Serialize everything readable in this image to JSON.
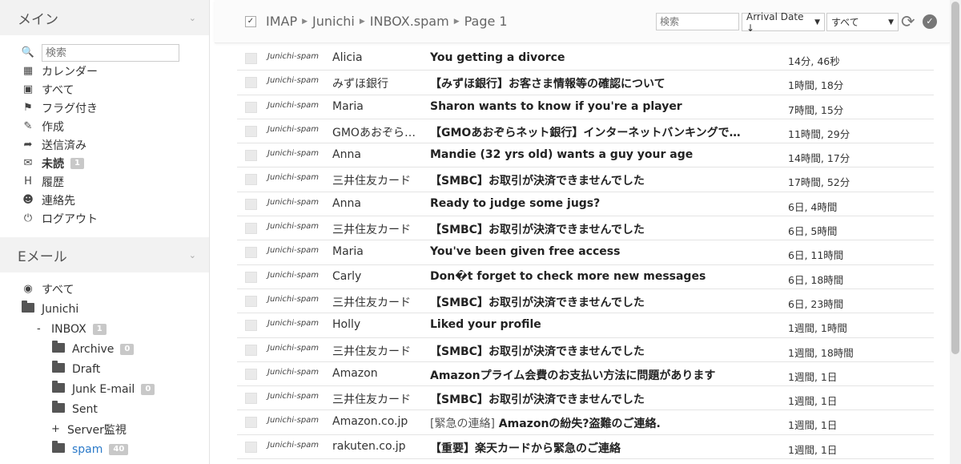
{
  "sidebar": {
    "main_section": {
      "title": "メイン",
      "search_placeholder": "検索",
      "items": [
        {
          "label": "カレンダー",
          "icon": "calendar-icon"
        },
        {
          "label": "すべて",
          "icon": "inbox-icon"
        },
        {
          "label": "フラグ付き",
          "icon": "flag-icon"
        },
        {
          "label": "作成",
          "icon": "compose-icon"
        },
        {
          "label": "送信済み",
          "icon": "sent-icon"
        },
        {
          "label": "未読",
          "icon": "envelope-icon",
          "badge": "1"
        },
        {
          "label": "履歴",
          "icon": "history-icon"
        },
        {
          "label": "連絡先",
          "icon": "contacts-icon"
        },
        {
          "label": "ログアウト",
          "icon": "power-icon"
        }
      ]
    },
    "email_section": {
      "title": "Eメール",
      "tree": {
        "all": "すべて",
        "account": "Junichi",
        "inbox": {
          "label": "INBOX",
          "badge": "1",
          "toggle": "-"
        },
        "archive": {
          "label": "Archive",
          "badge": "0"
        },
        "draft": {
          "label": "Draft"
        },
        "junk": {
          "label": "Junk E-mail",
          "badge": "0"
        },
        "sent": {
          "label": "Sent"
        },
        "server": {
          "label": "Server監視",
          "toggle": "+"
        },
        "spam": {
          "label": "spam",
          "badge": "40"
        }
      }
    }
  },
  "toolbar": {
    "breadcrumb": [
      "IMAP",
      "Junichi",
      "INBOX.spam",
      "Page 1"
    ],
    "search_placeholder": "検索",
    "sort_value": "Arrival Date ↓",
    "filter_value": "すべて"
  },
  "messages": [
    {
      "account": "Junichi-spam",
      "from": "Alicia",
      "subject": "You getting a divorce",
      "date": "14分, 46秒"
    },
    {
      "account": "Junichi-spam",
      "from": "みずほ銀行",
      "subject": "【みずほ銀行】お客さま情報等の確認について",
      "date": "1時間, 18分"
    },
    {
      "account": "Junichi-spam",
      "from": "Maria",
      "subject": "Sharon wants to know if you're a player",
      "date": "7時間, 15分"
    },
    {
      "account": "Junichi-spam",
      "from": "GMOあおぞら…",
      "subject": "【GMOあおぞらネット銀行】インターネットバンキングで…",
      "date": "11時間, 29分"
    },
    {
      "account": "Junichi-spam",
      "from": "Anna",
      "subject": "Mandie (32 yrs old) wants a guy your age",
      "date": "14時間, 17分"
    },
    {
      "account": "Junichi-spam",
      "from": "三井住友カード",
      "subject": "【SMBC】お取引が決済できませんでした",
      "date": "17時間, 52分"
    },
    {
      "account": "Junichi-spam",
      "from": "Anna",
      "subject": "Ready to judge some jugs?",
      "date": "6日, 4時間"
    },
    {
      "account": "Junichi-spam",
      "from": "三井住友カード",
      "subject": "【SMBC】お取引が決済できませんでした",
      "date": "6日, 5時間"
    },
    {
      "account": "Junichi-spam",
      "from": "Maria",
      "subject": "You've been given free access",
      "date": "6日, 11時間"
    },
    {
      "account": "Junichi-spam",
      "from": "Carly",
      "subject": "Don�t forget to check more new messages",
      "date": "6日, 18時間"
    },
    {
      "account": "Junichi-spam",
      "from": "三井住友カード",
      "subject": "【SMBC】お取引が決済できませんでした",
      "date": "6日, 23時間"
    },
    {
      "account": "Junichi-spam",
      "from": "Holly",
      "subject": "Liked your profile",
      "date": "1週間, 1時間"
    },
    {
      "account": "Junichi-spam",
      "from": "三井住友カード",
      "subject": "【SMBC】お取引が決済できませんでした",
      "date": "1週間, 18時間"
    },
    {
      "account": "Junichi-spam",
      "from": "Amazon",
      "subject": "Amazonプライム会費のお支払い方法に問題があります",
      "date": "1週間, 1日"
    },
    {
      "account": "Junichi-spam",
      "from": "三井住友カード",
      "subject": "【SMBC】お取引が決済できませんでした",
      "date": "1週間, 1日"
    },
    {
      "account": "Junichi-spam",
      "from": "Amazon.co.jp",
      "subject_tag": "[緊急の連絡]",
      "subject": " Amazonの紛失?盗難のご連絡.",
      "date": "1週間, 1日"
    },
    {
      "account": "Junichi-spam",
      "from": "rakuten.co.jp",
      "subject": "【重要】楽天カードから緊急のご連絡",
      "date": "1週間, 1日"
    }
  ]
}
